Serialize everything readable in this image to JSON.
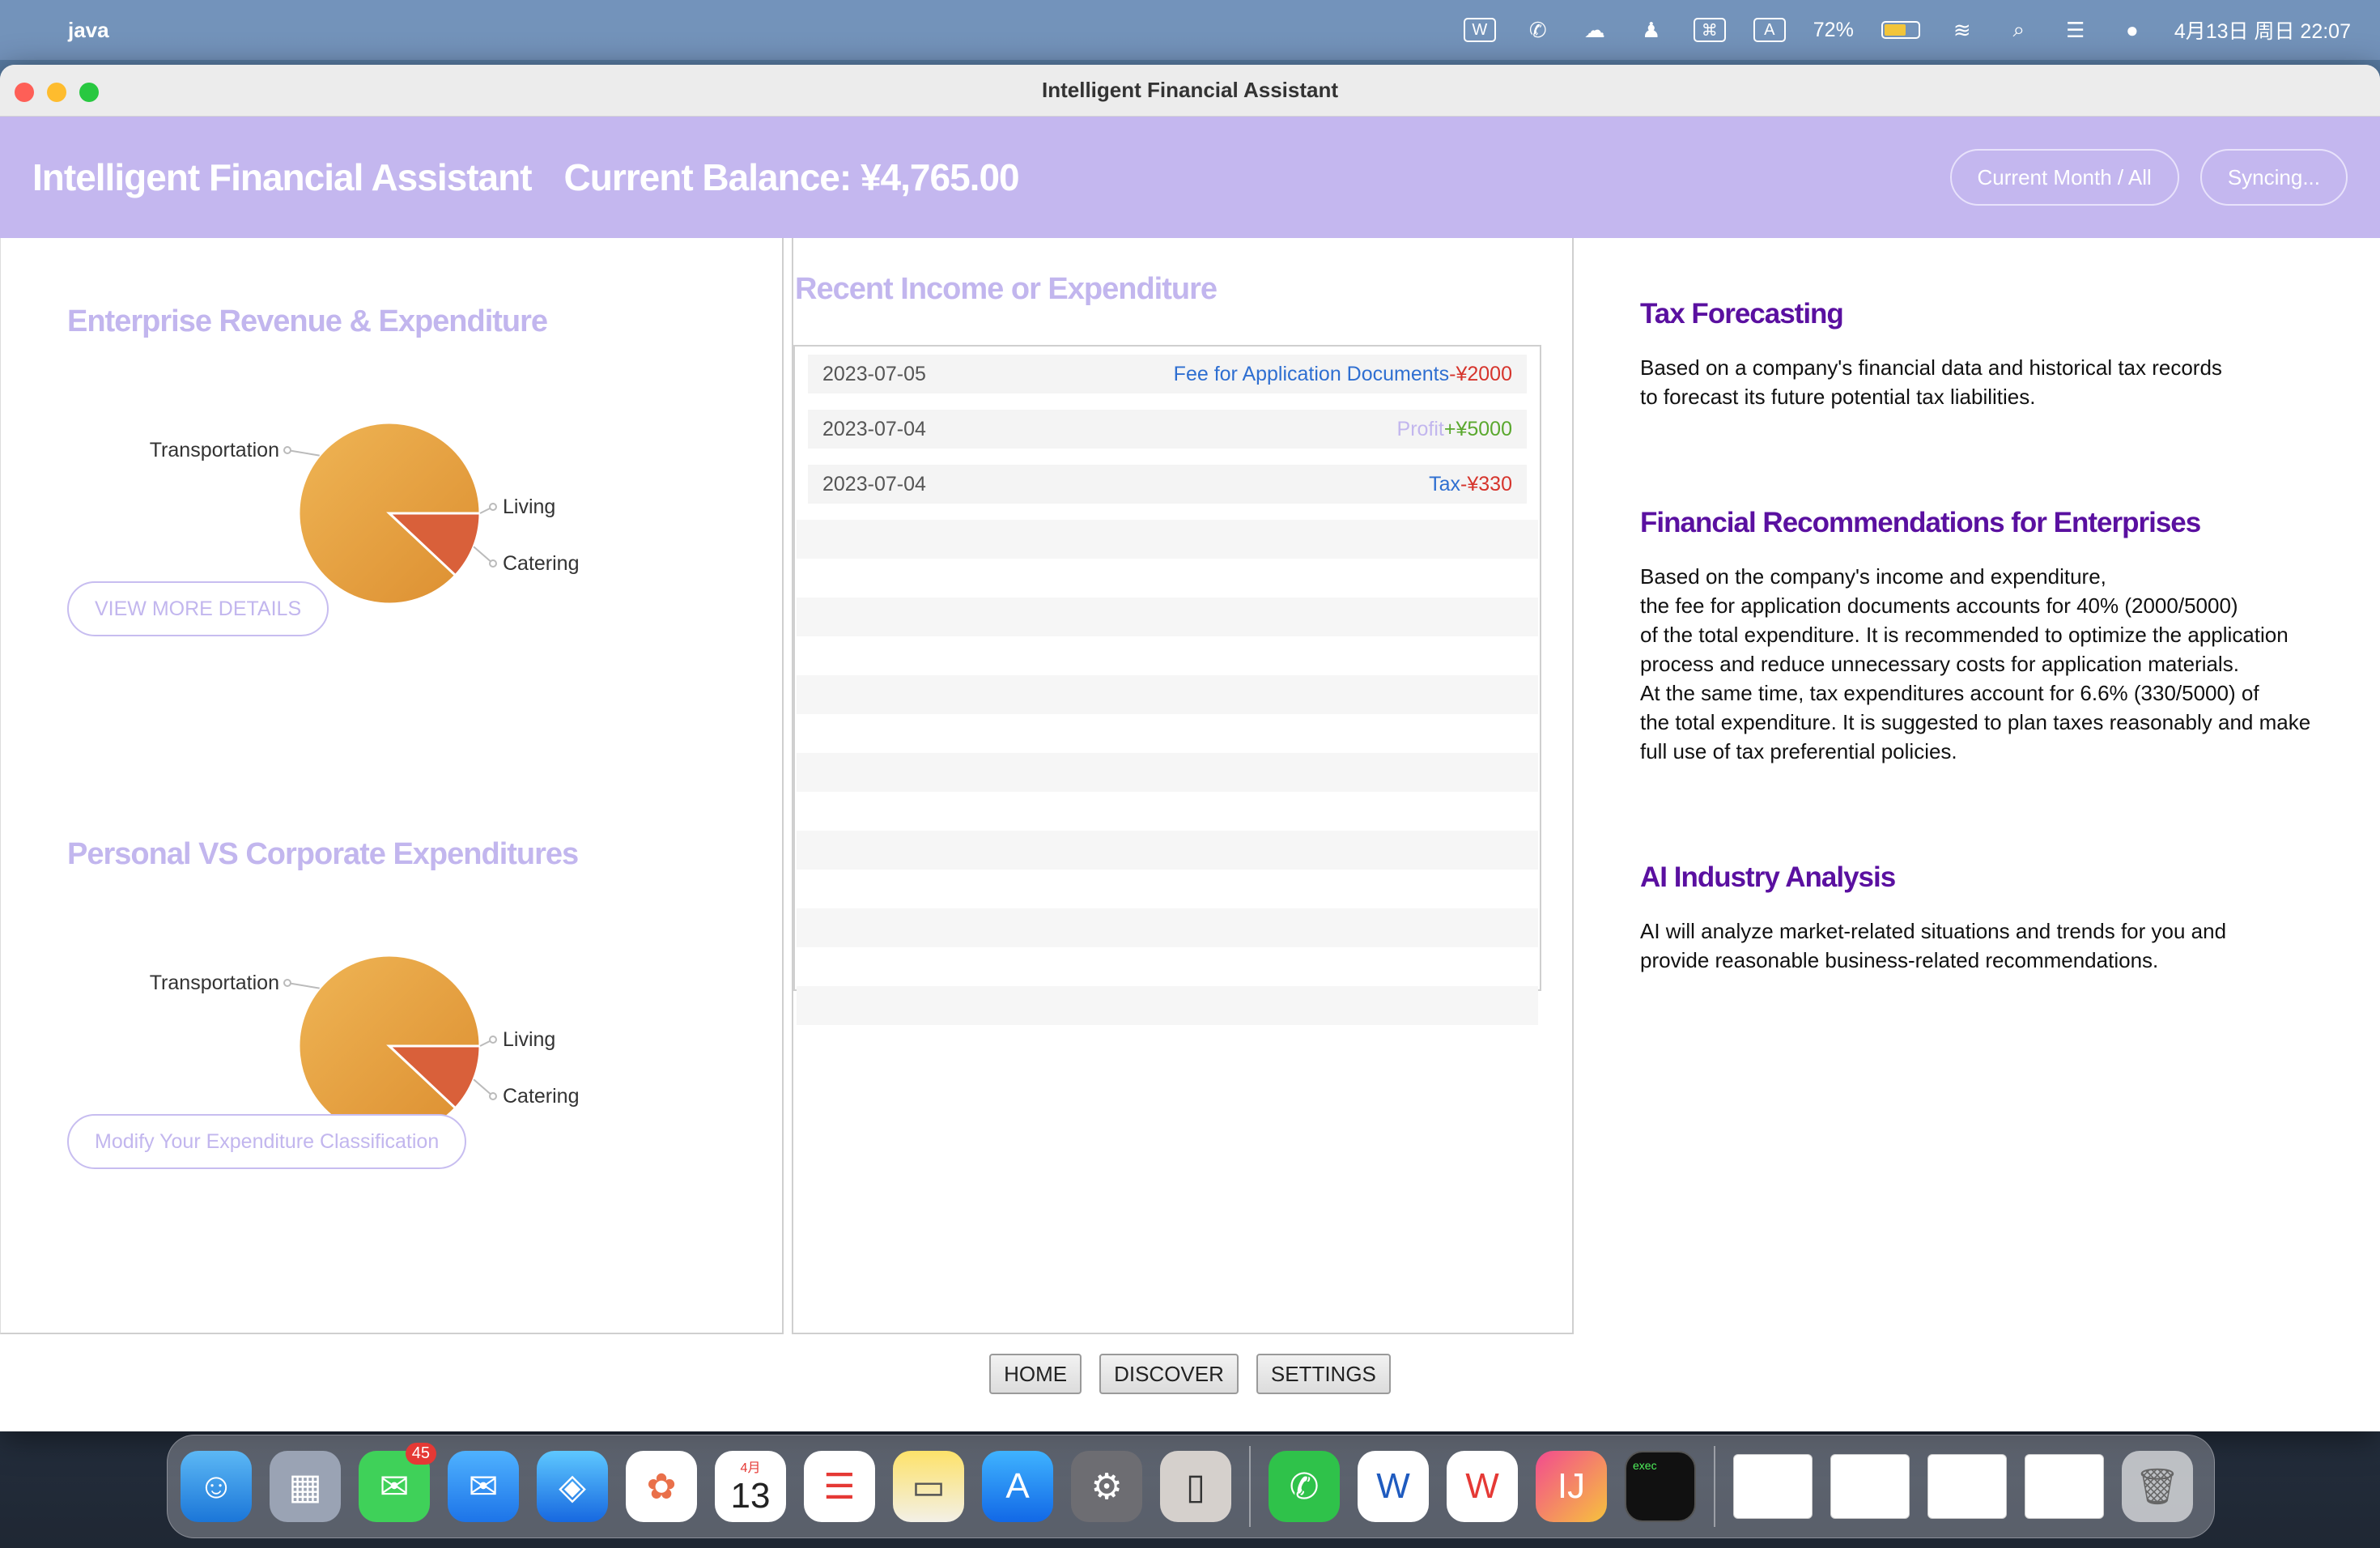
{
  "menubar": {
    "app_name": "java",
    "battery": "72%",
    "datetime": "4月13日 周日 22:07",
    "icons": [
      "apple-icon",
      "wps-icon",
      "wechat-icon",
      "cloud-icon",
      "accessibility-icon",
      "gamepad-icon",
      "input-method-icon",
      "battery-icon",
      "wifi-icon",
      "search-icon",
      "control-center-icon",
      "siri-icon"
    ]
  },
  "window": {
    "title": "Intelligent Financial Assistant"
  },
  "header": {
    "app_title": "Intelligent Financial Assistant",
    "balance": "Current Balance: ¥4,765.00",
    "filter_button": "Current Month / All",
    "sync_button": "Syncing..."
  },
  "left": {
    "chart1_title": "Enterprise Revenue & Expenditure",
    "chart1_button": "VIEW MORE DETAILS",
    "chart2_title": "Personal VS Corporate Expenditures",
    "chart2_button": "Modify Your Expenditure Classification"
  },
  "chart_data": [
    {
      "type": "pie",
      "title": "Enterprise Revenue & Expenditure",
      "categories": [
        "Transportation",
        "Living",
        "Catering"
      ],
      "values": [
        0,
        88,
        12
      ],
      "colors": [
        "#e9a94a",
        "#e29a3a",
        "#d9603a"
      ]
    },
    {
      "type": "pie",
      "title": "Personal VS Corporate Expenditures",
      "categories": [
        "Transportation",
        "Living",
        "Catering"
      ],
      "values": [
        0,
        88,
        12
      ],
      "colors": [
        "#e9a94a",
        "#e29a3a",
        "#d9603a"
      ]
    }
  ],
  "middle": {
    "title": "Recent Income or Expenditure",
    "records": [
      {
        "date": "2023-07-05",
        "label": "Fee for Application Documents",
        "amount": "-¥2000",
        "label_color": "#2f6fd1",
        "amount_color": "#d6342c"
      },
      {
        "date": "2023-07-04",
        "label": "Profit",
        "amount": "+¥5000",
        "label_color": "#c2b6ee",
        "amount_color": "#5aa82e"
      },
      {
        "date": "2023-07-04",
        "label": "Tax",
        "amount": "-¥330",
        "label_color": "#2f6fd1",
        "amount_color": "#d6342c"
      }
    ]
  },
  "right": {
    "tax_title": "Tax Forecasting",
    "tax_text": "Based on a company's financial data and historical tax records\n to forecast its future potential tax liabilities.",
    "rec_title": "Financial Recommendations for Enterprises",
    "rec_text": "Based on the company's income and expenditure,\n the fee for application documents accounts for 40% (2000/5000)\n of the total expenditure. It is recommended to optimize the application\n process and reduce unnecessary costs for application materials.\n At the same time, tax expenditures account for 6.6% (330/5000) of\n the total expenditure. It is suggested to plan taxes reasonably and make\n full use of tax preferential policies.",
    "ai_title": "AI Industry Analysis",
    "ai_text": "AI will analyze market-related situations and trends for you and\n provide reasonable business-related recommendations."
  },
  "nav": {
    "home": "HOME",
    "discover": "DISCOVER",
    "settings": "SETTINGS"
  },
  "dock": {
    "messages_badge": "45",
    "calendar_month": "4月",
    "calendar_day": "13",
    "terminal_text": "exec"
  }
}
